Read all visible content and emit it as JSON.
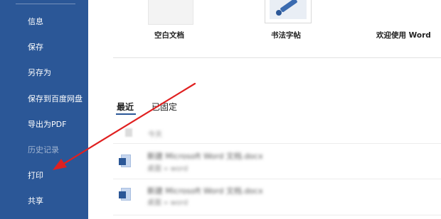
{
  "sidebar": {
    "items": [
      {
        "label": "信息"
      },
      {
        "label": "保存"
      },
      {
        "label": "另存为"
      },
      {
        "label": "保存到百度网盘"
      },
      {
        "label": "导出为PDF"
      },
      {
        "label": "历史记录",
        "disabled": true
      },
      {
        "label": "打印"
      },
      {
        "label": "共享"
      }
    ]
  },
  "templates": [
    {
      "label": "空白文档",
      "icon": "blank-document-icon"
    },
    {
      "label": "书法字帖",
      "icon": "calligraphy-icon"
    },
    {
      "label": "欢迎使用 Word",
      "icon": "welcome-document-icon"
    }
  ],
  "tabs": [
    {
      "label": "最近",
      "active": true
    },
    {
      "label": "已固定",
      "active": false
    }
  ],
  "recent": {
    "group_label": "今天",
    "files": [
      {
        "name": "新建 Microsoft Word 文档.docx",
        "path": "桌面 » word"
      },
      {
        "name": "新建 Microsoft Word 文档.docx",
        "path": "桌面 » word"
      }
    ]
  },
  "colors": {
    "sidebar": "#2b5797",
    "arrow": "#e02020"
  }
}
